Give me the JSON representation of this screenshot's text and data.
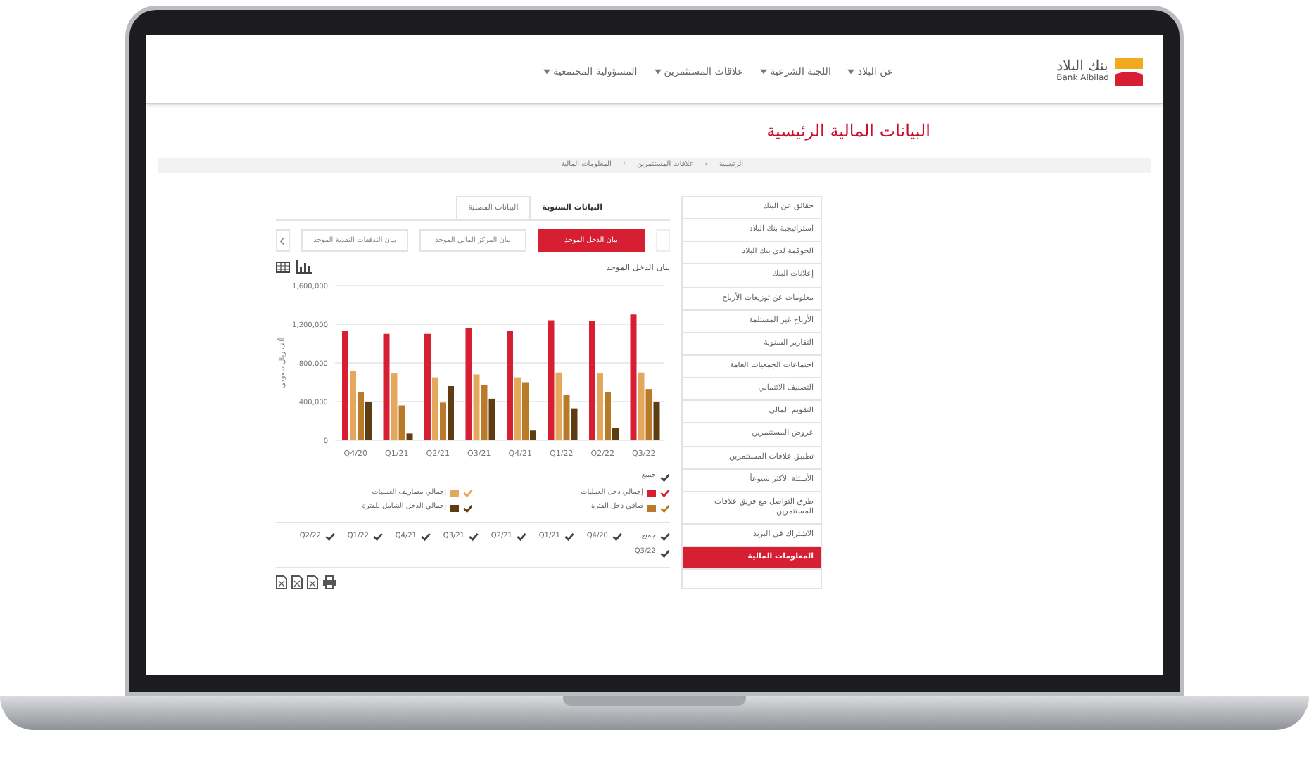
{
  "header": {
    "logo_arabic": "بنك البلاد",
    "logo_latin": "Bank Albilad",
    "nav": [
      {
        "label": "عن البلاد"
      },
      {
        "label": "اللجنة الشرعية"
      },
      {
        "label": "علاقات المستثمرين"
      },
      {
        "label": "المسؤولية المجتمعية"
      }
    ]
  },
  "page_title": "البيانات المالية الرئيسية",
  "breadcrumb": {
    "separator": "›",
    "items": [
      "الرئيسية",
      "علاقات المستثمرين",
      "المعلومات المالية"
    ]
  },
  "sidebar": {
    "items": [
      {
        "label": "حقائق عن البنك",
        "selected": false
      },
      {
        "label": "استراتيجية بنك البلاد",
        "selected": false
      },
      {
        "label": "الحوكمة لدى بنك البلاد",
        "selected": false
      },
      {
        "label": "إعلانات البنك",
        "selected": false
      },
      {
        "label": "معلومات عن توزيعات الأرباح",
        "selected": false
      },
      {
        "label": "الأرباح غير المستلمة",
        "selected": false
      },
      {
        "label": "التقارير السنوية",
        "selected": false
      },
      {
        "label": "اجتماعات الجمعيات العامة",
        "selected": false
      },
      {
        "label": "التصنيف الائتماني",
        "selected": false
      },
      {
        "label": "التقويم المالي",
        "selected": false
      },
      {
        "label": "عروض المستثمرين",
        "selected": false
      },
      {
        "label": "تطبيق علاقات المستثمرين",
        "selected": false
      },
      {
        "label": "الأسئلة الأكثر شيوعاً",
        "selected": false
      },
      {
        "label": "طرق التواصل مع فريق علاقات المستثمرين",
        "selected": false
      },
      {
        "label": "الاشتراك في البريد",
        "selected": false
      },
      {
        "label": "المعلومات المالية",
        "selected": true
      }
    ]
  },
  "tabs": [
    {
      "label": "البيانات السنوية",
      "selected": true
    },
    {
      "label": "البيانات الفصلية",
      "selected": false
    }
  ],
  "statements": [
    {
      "label": "بيان الدخل الموحد",
      "selected": true
    },
    {
      "label": "بيان المركز المالي الموحد",
      "selected": false
    },
    {
      "label": "بيان التدفقات النقدية الموحد",
      "selected": false
    }
  ],
  "chart": {
    "title": "بيان الدخل الموحد",
    "chart_data": {
      "type": "bar",
      "grid": true,
      "ylabel": "ألف ريال سعودي",
      "categories": [
        "Q4/20",
        "Q1/21",
        "Q2/21",
        "Q3/21",
        "Q4/21",
        "Q1/22",
        "Q2/22",
        "Q3/22"
      ],
      "ylim": [
        0,
        1600000
      ],
      "yticks": [
        {
          "value": 0,
          "label": "0"
        },
        {
          "value": 400000,
          "label": "400,000"
        },
        {
          "value": 800000,
          "label": "800,000"
        },
        {
          "value": 1200000,
          "label": "1,200,000"
        },
        {
          "value": 1600000,
          "label": "1,600,000"
        }
      ],
      "series": [
        {
          "name": "إجمالي دخل العمليات",
          "color": "#d71f34",
          "values": [
            1130000,
            1100000,
            1100000,
            1160000,
            1130000,
            1240000,
            1230000,
            1300000
          ]
        },
        {
          "name": "إجمالي مصاريف العمليات",
          "color": "#e3a85c",
          "values": [
            720000,
            690000,
            650000,
            680000,
            650000,
            700000,
            690000,
            700000
          ]
        },
        {
          "name": "صافي دخل الفترة",
          "color": "#b97a2a",
          "values": [
            500000,
            360000,
            390000,
            570000,
            600000,
            470000,
            500000,
            530000
          ]
        },
        {
          "name": "إجمالي الدخل الشامل للفترة",
          "color": "#5e3d12",
          "values": [
            400000,
            70000,
            560000,
            430000,
            100000,
            330000,
            130000,
            400000
          ]
        }
      ]
    }
  },
  "legend": {
    "all_label": "جميع",
    "all_checked": true,
    "items": [
      {
        "checked": true
      },
      {
        "checked": true
      },
      {
        "checked": true
      },
      {
        "checked": true
      }
    ]
  },
  "periods": {
    "all_label": "جميع",
    "all_checked": true,
    "items": [
      {
        "label": "Q4/20",
        "checked": true
      },
      {
        "label": "Q1/21",
        "checked": true
      },
      {
        "label": "Q2/21",
        "checked": true
      },
      {
        "label": "Q3/21",
        "checked": true
      },
      {
        "label": "Q4/21",
        "checked": true
      },
      {
        "label": "Q1/22",
        "checked": true
      },
      {
        "label": "Q2/22",
        "checked": true
      },
      {
        "label": "Q3/22",
        "checked": true
      }
    ]
  }
}
